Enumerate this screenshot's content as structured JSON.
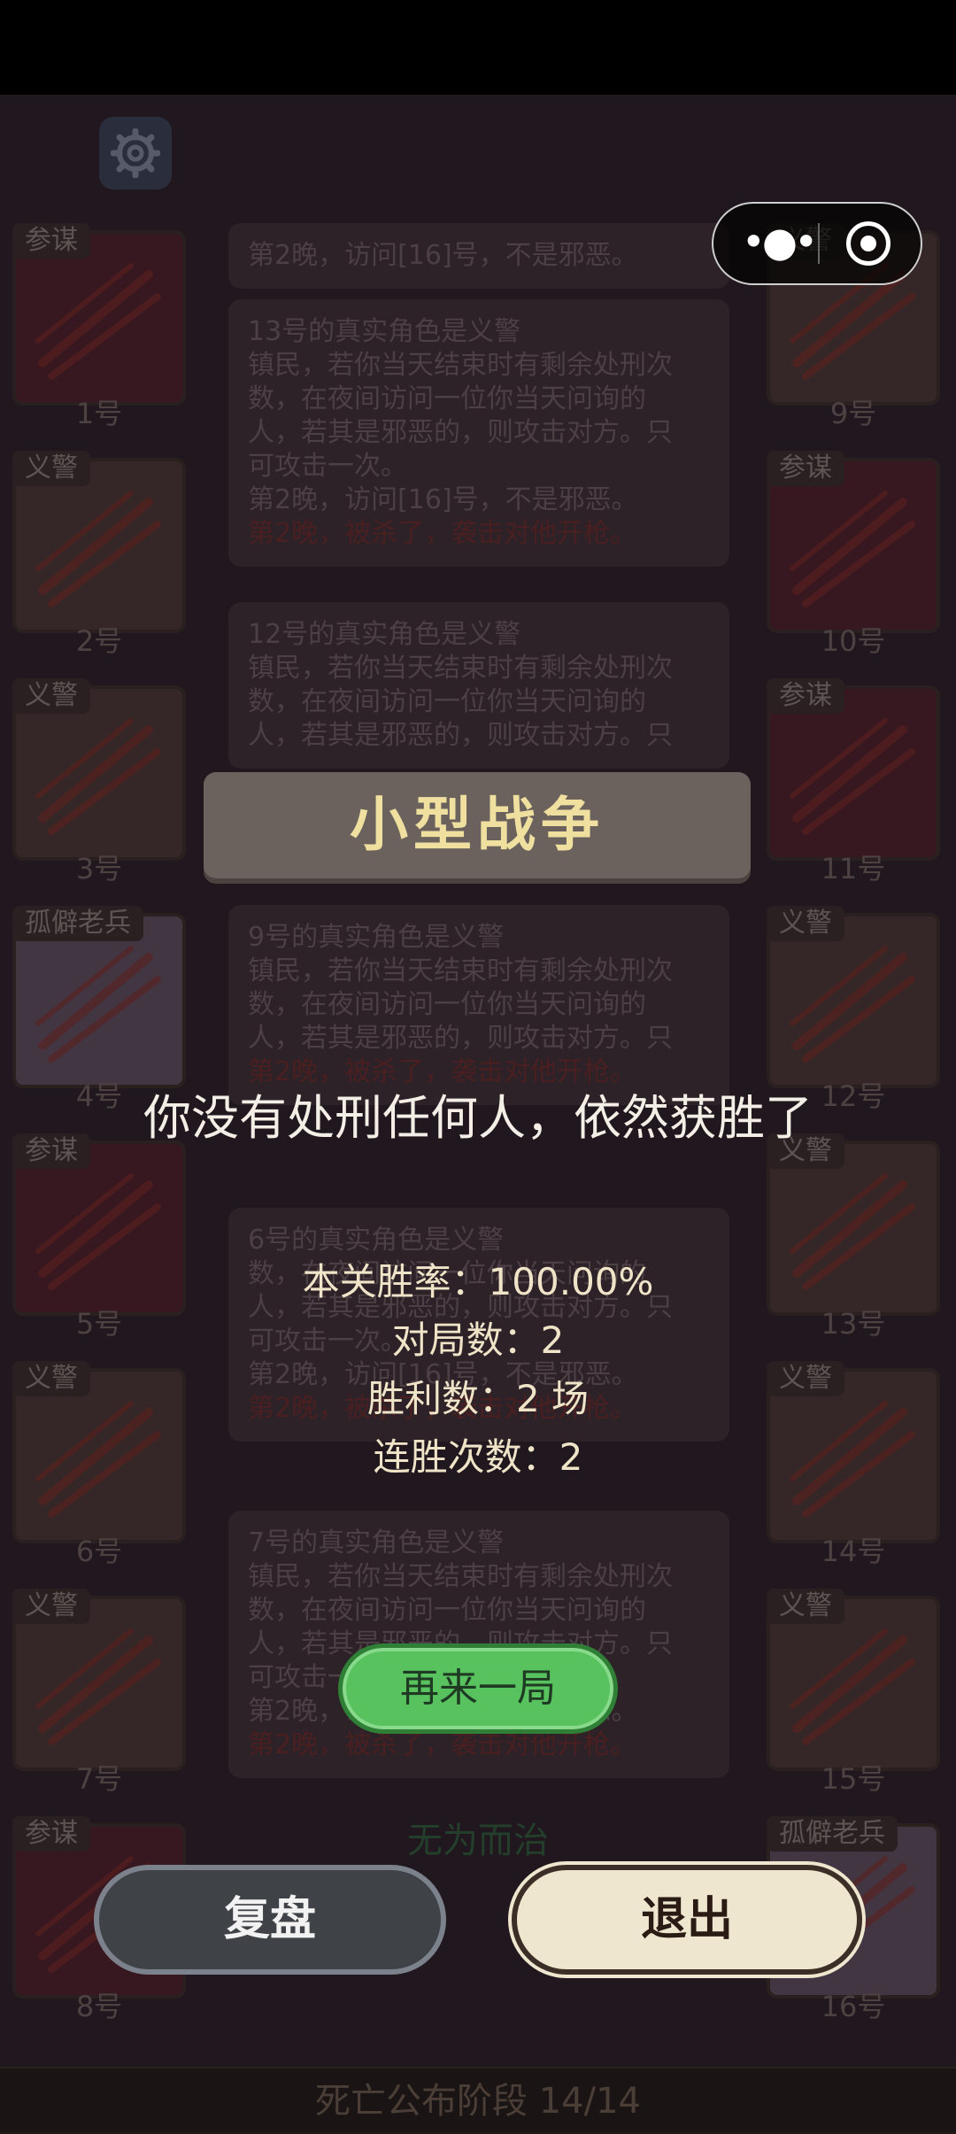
{
  "header": {
    "settings_icon": "gear-icon"
  },
  "mini_program_capsule": {
    "menu_icon": "more-dots-icon",
    "close_icon": "target-close-icon"
  },
  "players_left": [
    {
      "role": "参谋",
      "number": "1号",
      "type": "evil"
    },
    {
      "role": "义警",
      "number": "2号",
      "type": "good"
    },
    {
      "role": "义警",
      "number": "3号",
      "type": "good"
    },
    {
      "role": "孤僻老兵",
      "number": "4号",
      "type": "vet"
    },
    {
      "role": "参谋",
      "number": "5号",
      "type": "evil"
    },
    {
      "role": "义警",
      "number": "6号",
      "type": "good"
    },
    {
      "role": "义警",
      "number": "7号",
      "type": "good"
    },
    {
      "role": "参谋",
      "number": "8号",
      "type": "evil"
    }
  ],
  "players_right": [
    {
      "role": "义警",
      "number": "9号",
      "type": "good"
    },
    {
      "role": "参谋",
      "number": "10号",
      "type": "evil"
    },
    {
      "role": "参谋",
      "number": "11号",
      "type": "evil"
    },
    {
      "role": "义警",
      "number": "12号",
      "type": "good"
    },
    {
      "role": "义警",
      "number": "13号",
      "type": "good"
    },
    {
      "role": "义警",
      "number": "14号",
      "type": "good"
    },
    {
      "role": "义警",
      "number": "15号",
      "type": "good"
    },
    {
      "role": "孤僻老兵",
      "number": "16号",
      "type": "vet"
    }
  ],
  "log": [
    {
      "lines": [
        "第2晚，访问[16]号，不是邪恶。"
      ],
      "red": ""
    },
    {
      "lines": [
        "13号的真实角色是义警",
        "镇民，若你当天结束时有剩余处刑次",
        "数，在夜间访问一位你当天问询的",
        "人，若其是邪恶的，则攻击对方。只",
        "可攻击一次。",
        "第2晚，访问[16]号，不是邪恶。"
      ],
      "red": "第2晚，被杀了，袭击对他开枪。"
    },
    {
      "lines": [
        "12号的真实角色是义警",
        "镇民，若你当天结束时有剩余处刑次",
        "数，在夜间访问一位你当天问询的",
        "人，若其是邪恶的，则攻击对方。只"
      ],
      "red": ""
    },
    {
      "lines": [
        "9号的真实角色是义警",
        "镇民，若你当天结束时有剩余处刑次",
        "数，在夜间访问一位你当天问询的",
        "人，若其是邪恶的，则攻击对方。只"
      ],
      "red": "第2晚，被杀了，袭击对他开枪。"
    },
    {
      "lines": [
        "6号的真实角色是义警",
        "数，在夜间访问一位你当天问询的",
        "人，若其是邪恶的，则攻击对方。只",
        "可攻击一次。",
        "第2晚，访问[16]号，不是邪恶。"
      ],
      "red": "第2晚，被杀了，袭击对他开枪。"
    },
    {
      "lines": [
        "7号的真实角色是义警",
        "镇民，若你当天结束时有剩余处刑次",
        "数，在夜间访问一位你当天问询的",
        "人，若其是邪恶的，则攻击对方。只",
        "可攻击一次。",
        "第2晚，访问[16]号，不是邪恶。"
      ],
      "red": "第2晚，被杀了，袭击对他开枪。"
    }
  ],
  "result": {
    "title": "小型战争",
    "headline": "你没有处刑任何人，依然获胜了",
    "win_rate": "本关胜率：100.00%",
    "games": "对局数：2",
    "wins": "胜利数：2 场",
    "streak": "连胜次数：2"
  },
  "buttons": {
    "play_again": "再来一局",
    "review": "复盘",
    "exit": "退出"
  },
  "section_label": "无为而治",
  "footer": "死亡公布阶段 14/14",
  "colors": {
    "accent_title": "#efe0a0",
    "play_again_green": "#58c25f",
    "exit_cream": "#efe6cf"
  }
}
